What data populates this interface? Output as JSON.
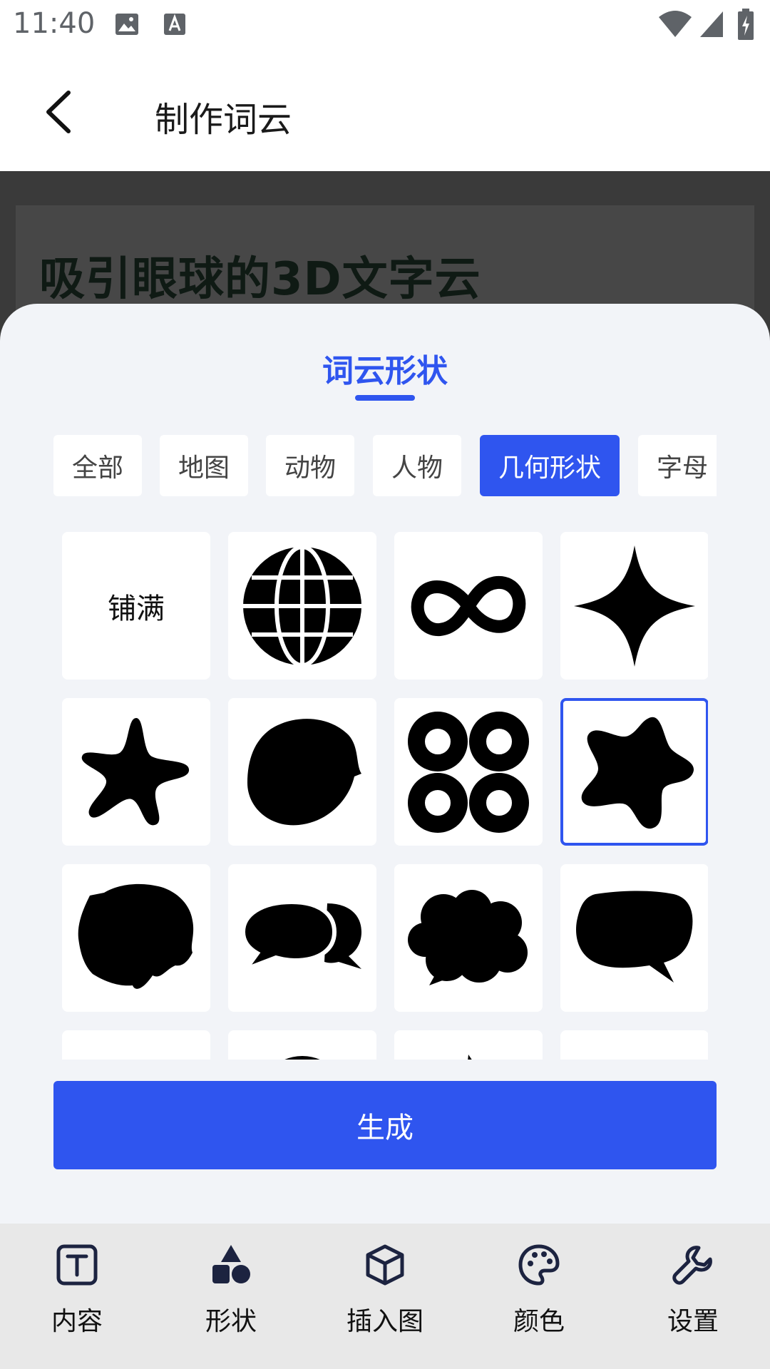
{
  "status_bar": {
    "time": "11:40"
  },
  "app_bar": {
    "title": "制作词云"
  },
  "preview": {
    "headline": "吸引眼球的3D文字云"
  },
  "sheet": {
    "title": "词云形状",
    "tabs": [
      {
        "label": "全部",
        "active": false
      },
      {
        "label": "地图",
        "active": false
      },
      {
        "label": "动物",
        "active": false
      },
      {
        "label": "人物",
        "active": false
      },
      {
        "label": "几何形状",
        "active": true
      },
      {
        "label": "字母",
        "active": false
      }
    ],
    "shapes": [
      {
        "name": "fill",
        "label": "铺满"
      },
      {
        "name": "globe-icon"
      },
      {
        "name": "infinity-icon"
      },
      {
        "name": "four-point-star-icon"
      },
      {
        "name": "starfish-icon"
      },
      {
        "name": "blob-icon"
      },
      {
        "name": "four-rings-icon"
      },
      {
        "name": "rounded-star-icon",
        "selected": true
      },
      {
        "name": "rough-blob-icon"
      },
      {
        "name": "speech-bubbles-icon"
      },
      {
        "name": "cloud-bubble-icon"
      },
      {
        "name": "speech-bubble-icon"
      }
    ],
    "generate_label": "生成"
  },
  "bottom_nav": [
    {
      "label": "内容",
      "icon": "text-box-icon"
    },
    {
      "label": "形状",
      "icon": "shapes-icon"
    },
    {
      "label": "插入图",
      "icon": "cube-icon"
    },
    {
      "label": "颜色",
      "icon": "palette-icon"
    },
    {
      "label": "设置",
      "icon": "wrench-icon"
    }
  ],
  "colors": {
    "accent": "#2f55ef",
    "sheet_bg": "#f2f4f8",
    "nav_bg": "#e8e8e8"
  }
}
